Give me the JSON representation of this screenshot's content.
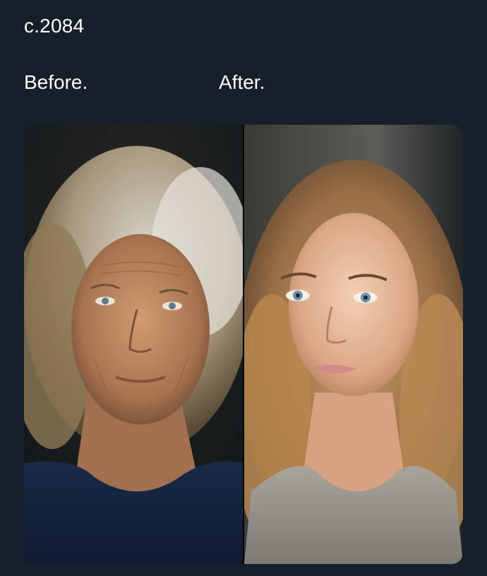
{
  "post": {
    "line1": "c.2084",
    "before_label": "Before.",
    "after_label": "After."
  },
  "media": {
    "left_image": "portrait-elderly-woman-gray-curly-hair-navy-sweater",
    "right_image": "portrait-young-woman-wavy-blonde-hair-gray-sweater"
  },
  "colors": {
    "background": "#15202b",
    "text": "#ffffff"
  }
}
